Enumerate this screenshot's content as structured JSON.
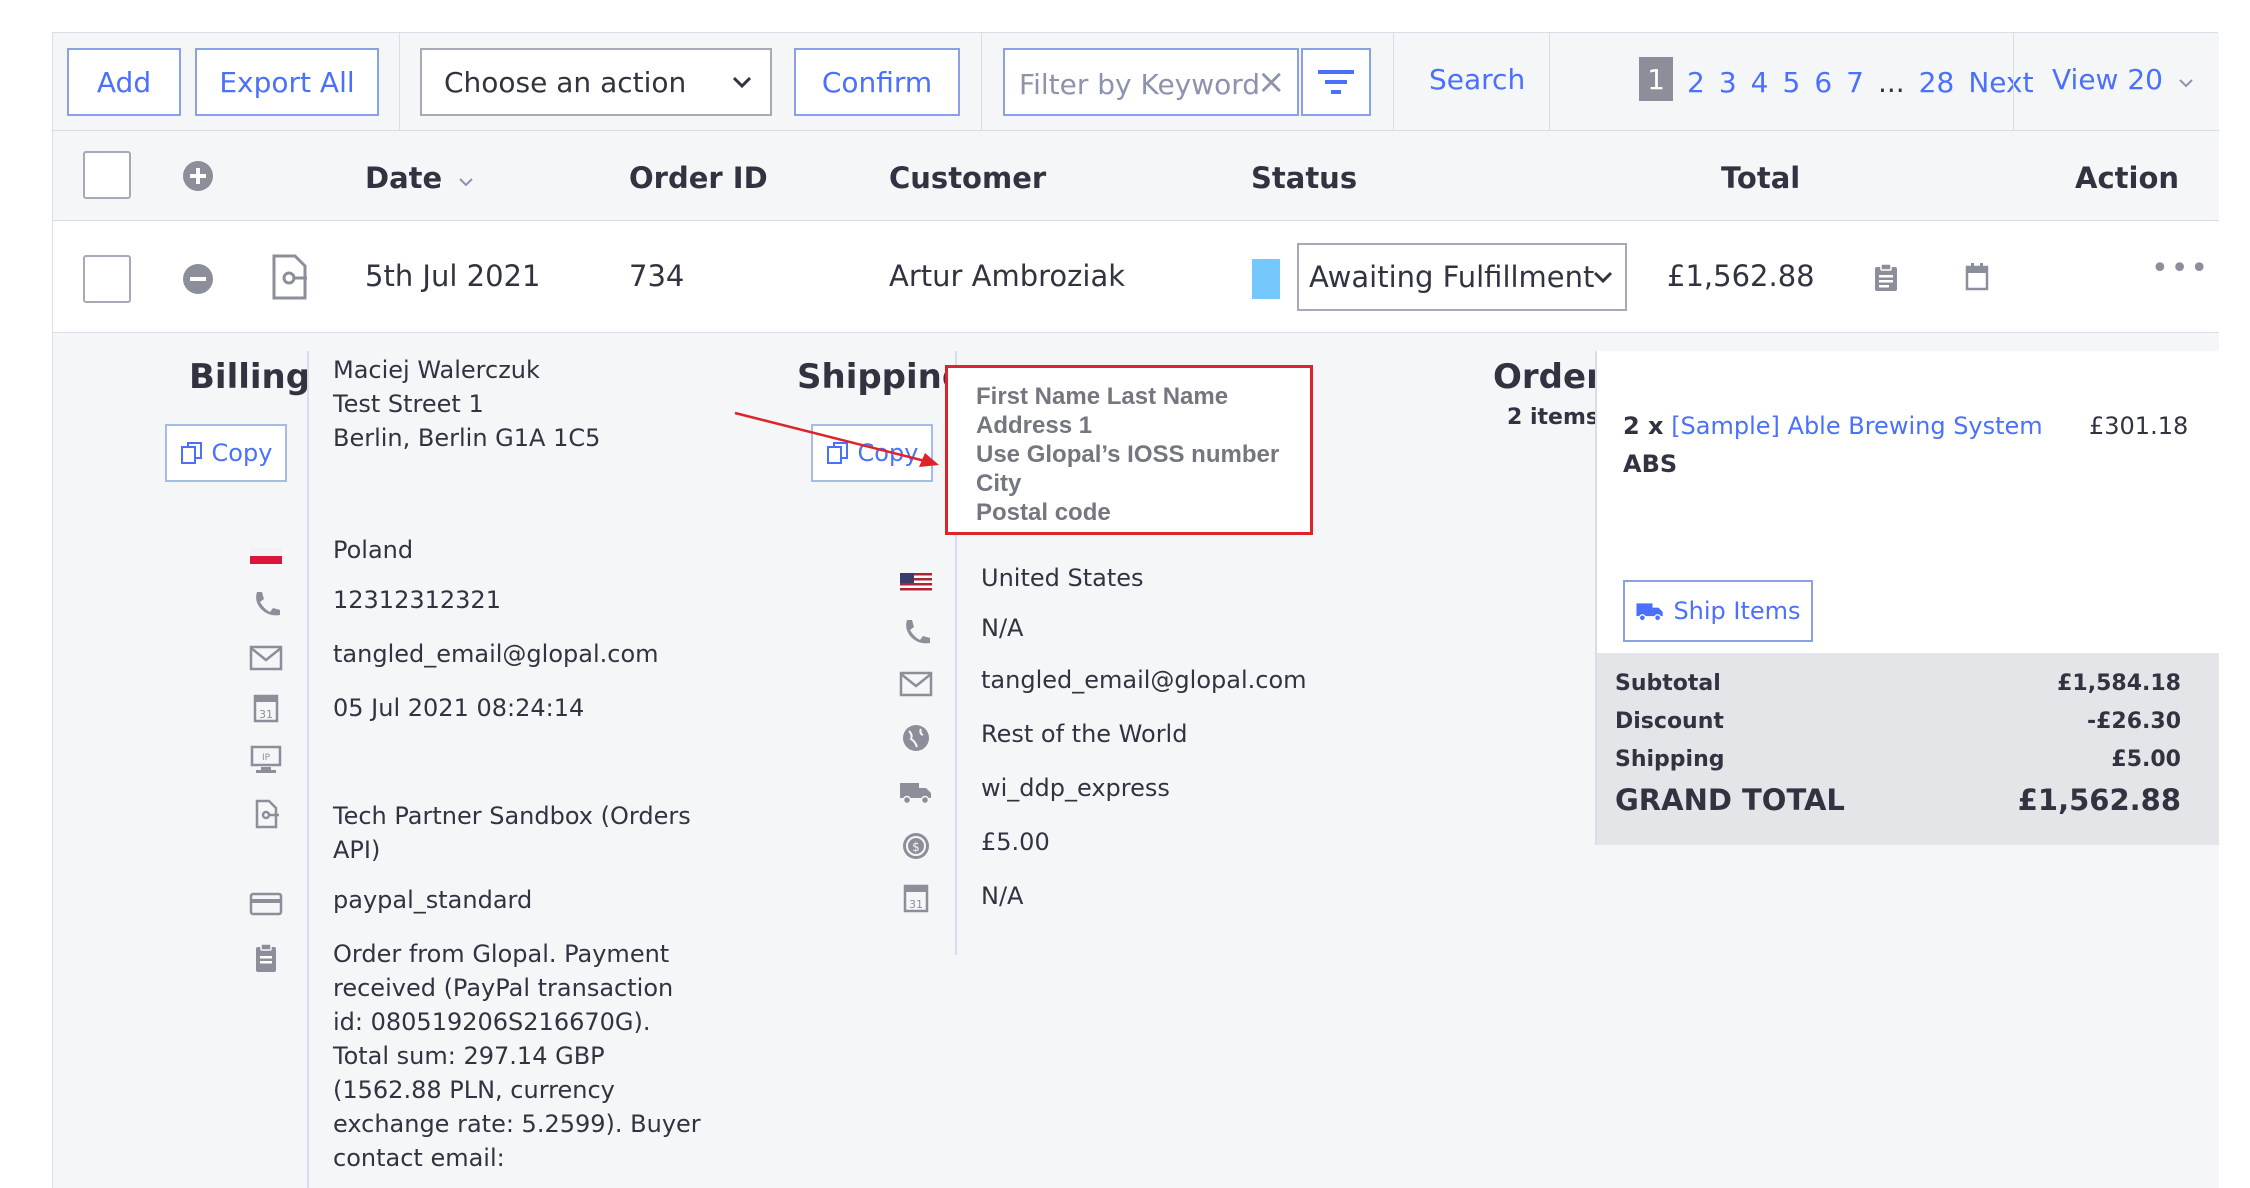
{
  "toolbar": {
    "add_label": "Add",
    "export_label": "Export All",
    "action_select": "Choose an action",
    "confirm_label": "Confirm",
    "filter_placeholder": "Filter by Keyword",
    "filter_clear": "×",
    "search_label": "Search",
    "pagination": {
      "current": "1",
      "pages": [
        "2",
        "3",
        "4",
        "5",
        "6",
        "7"
      ],
      "ellipsis": "...",
      "last": "28",
      "next": "Next"
    },
    "view_label": "View 20"
  },
  "table": {
    "headers": {
      "date": "Date",
      "order_id": "Order ID",
      "customer": "Customer",
      "status": "Status",
      "total": "Total",
      "action": "Action"
    },
    "row": {
      "date": "5th Jul 2021",
      "order_id": "734",
      "customer": "Artur Ambroziak",
      "status": "Awaiting Fulfillment",
      "status_color": "#74c8fb",
      "total": "£1,562.88",
      "more": "•••"
    }
  },
  "billing": {
    "title": "Billing",
    "copy_label": "Copy",
    "address": [
      "Maciej Walerczuk",
      "Test Street 1",
      "Berlin, Berlin G1A 1C5"
    ],
    "country": "Poland",
    "phone": "12312312321",
    "email": "tangled_email@glopal.com",
    "date": "05 Jul 2021 08:24:14",
    "channel": [
      "Tech Partner Sandbox (Orders",
      "API)"
    ],
    "payment": "paypal_standard",
    "comment": [
      "Order from Glopal. Payment",
      "received (PayPal transaction",
      "id: 080519206S216670G).",
      "Total sum: 297.14 GBP",
      "(1562.88 PLN, currency",
      "exchange rate: 5.2599). Buyer",
      "contact email:"
    ]
  },
  "shipping": {
    "title": "Shipping",
    "copy_label": "Copy",
    "annotation": [
      "First Name Last Name",
      "Address 1",
      "Use Glopal’s IOSS number",
      "City",
      "Postal code"
    ],
    "country": "United States",
    "phone": "N/A",
    "email": "tangled_email@glopal.com",
    "zone": "Rest of the World",
    "method": "wi_ddp_express",
    "cost": "£5.00",
    "date": "N/A"
  },
  "order": {
    "title": "Order",
    "count": "2 items",
    "item_qty": "2 x",
    "item_name": "[Sample] Able Brewing System",
    "item_price": "£301.18",
    "item_sku": "ABS",
    "ship_items_label": "Ship Items",
    "totals": {
      "subtotal_label": "Subtotal",
      "subtotal": "£1,584.18",
      "discount_label": "Discount",
      "discount": "-£26.30",
      "shipping_label": "Shipping",
      "shipping": "£5.00",
      "grand_label": "GRAND TOTAL",
      "grand": "£1,562.88"
    }
  },
  "colors": {
    "accent": "#4b71fc",
    "highlight": "#e0232b"
  }
}
